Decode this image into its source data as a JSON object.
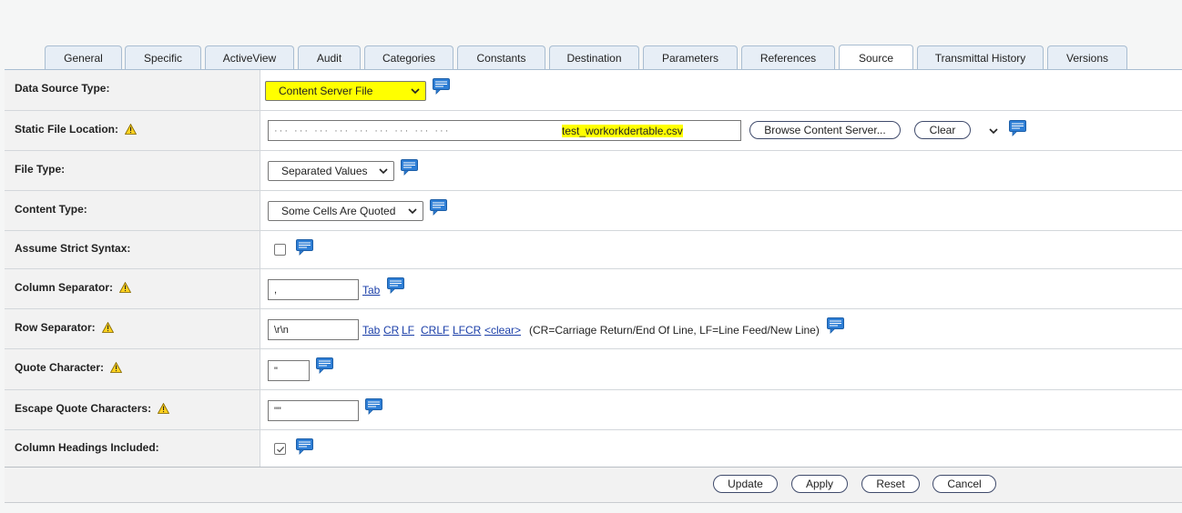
{
  "tabs": [
    {
      "label": "General"
    },
    {
      "label": "Specific"
    },
    {
      "label": "ActiveView"
    },
    {
      "label": "Audit"
    },
    {
      "label": "Categories"
    },
    {
      "label": "Constants"
    },
    {
      "label": "Destination"
    },
    {
      "label": "Parameters"
    },
    {
      "label": "References"
    },
    {
      "label": "Source",
      "active": true
    },
    {
      "label": "Transmittal History"
    },
    {
      "label": "Versions"
    }
  ],
  "form": {
    "data_source_type": {
      "label": "Data Source Type:",
      "value": "Content Server File"
    },
    "static_file_location": {
      "label": "Static File Location:",
      "path_hidden": "··· ··· ··· ··· ··· ··· ··· ··· ···",
      "file_name": "test_workorkdertable.csv",
      "browse_label": "Browse Content Server...",
      "clear_label": "Clear"
    },
    "file_type": {
      "label": "File Type:",
      "value": "Separated Values"
    },
    "content_type": {
      "label": "Content Type:",
      "value": "Some Cells Are Quoted"
    },
    "assume_strict_syntax": {
      "label": "Assume Strict Syntax:",
      "checked": false
    },
    "column_separator": {
      "label": "Column Separator:",
      "value": ",",
      "link_tab": "Tab"
    },
    "row_separator": {
      "label": "Row Separator:",
      "value": "\\r\\n",
      "links": [
        "Tab",
        "CR",
        "LF",
        "CRLF",
        "LFCR",
        "<clear>"
      ],
      "note": "(CR=Carriage Return/End Of Line, LF=Line Feed/New Line)"
    },
    "quote_character": {
      "label": "Quote Character:",
      "value": "\""
    },
    "escape_quote_characters": {
      "label": "Escape Quote Characters:",
      "value": "\"\""
    },
    "column_headings_included": {
      "label": "Column Headings Included:",
      "checked": true
    }
  },
  "footer": {
    "update": "Update",
    "apply": "Apply",
    "reset": "Reset",
    "cancel": "Cancel"
  },
  "colors": {
    "highlight": "#ffff00",
    "link": "#1a3ea8",
    "tab_bg": "#e7eef6",
    "tab_border": "#a9bdd1"
  },
  "icons": {
    "warning": "warning-icon",
    "comment": "comment-bubble-icon",
    "dropdown": "chevron-down-icon"
  }
}
